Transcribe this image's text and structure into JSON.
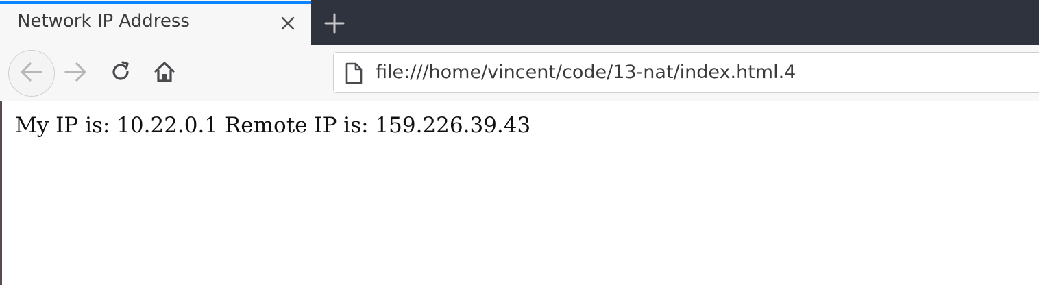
{
  "browser": {
    "tab": {
      "title": "Network IP Address",
      "close_icon": "close-icon"
    },
    "new_tab_icon": "plus-icon",
    "accent_color": "#0a84ff",
    "toolbar": {
      "back_icon": "arrow-left-icon",
      "forward_icon": "arrow-right-icon",
      "reload_icon": "reload-icon",
      "home_icon": "home-icon"
    },
    "address_bar": {
      "page_icon": "page-icon",
      "url": "file:///home/vincent/code/13-nat/index.html.4"
    }
  },
  "page": {
    "text": "My IP is: 10.22.0.1 Remote IP is: 159.226.39.43"
  }
}
